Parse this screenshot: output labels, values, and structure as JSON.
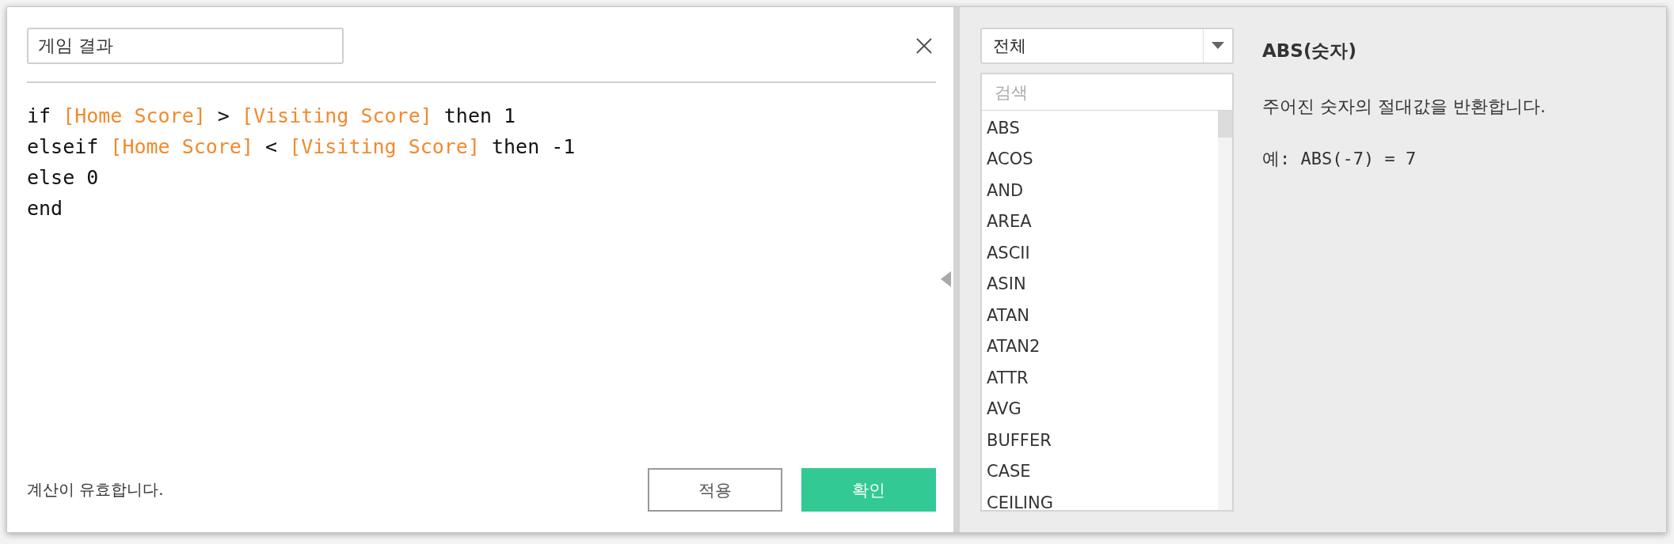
{
  "calc_name": {
    "value": "게임 결과"
  },
  "code_lines": [
    [
      {
        "kind": "keyword",
        "text": "if "
      },
      {
        "kind": "field",
        "text": "[Home Score]"
      },
      {
        "kind": "keyword",
        "text": " > "
      },
      {
        "kind": "field",
        "text": "[Visiting Score]"
      },
      {
        "kind": "keyword",
        "text": " then 1"
      }
    ],
    [
      {
        "kind": "keyword",
        "text": "elseif "
      },
      {
        "kind": "field",
        "text": "[Home Score]"
      },
      {
        "kind": "keyword",
        "text": " < "
      },
      {
        "kind": "field",
        "text": "[Visiting Score]"
      },
      {
        "kind": "keyword",
        "text": " then -1"
      }
    ],
    [
      {
        "kind": "keyword",
        "text": "else 0"
      }
    ],
    [
      {
        "kind": "keyword",
        "text": "end"
      }
    ]
  ],
  "status": "계산이 유효합니다.",
  "buttons": [
    {
      "label": "적용",
      "kind": "secondary"
    },
    {
      "label": "확인",
      "kind": "primary"
    }
  ],
  "category_dropdown": {
    "value": "전체"
  },
  "function_search": {
    "placeholder": "검색"
  },
  "functions": [
    "ABS",
    "ACOS",
    "AND",
    "AREA",
    "ASCII",
    "ASIN",
    "ATAN",
    "ATAN2",
    "ATTR",
    "AVG",
    "BUFFER",
    "CASE",
    "CEILING"
  ],
  "help": {
    "signature": "ABS(숫자)",
    "description": "주어진 숫자의 절대값을 반환합니다.",
    "example": "예: ABS(-7) = 7"
  }
}
